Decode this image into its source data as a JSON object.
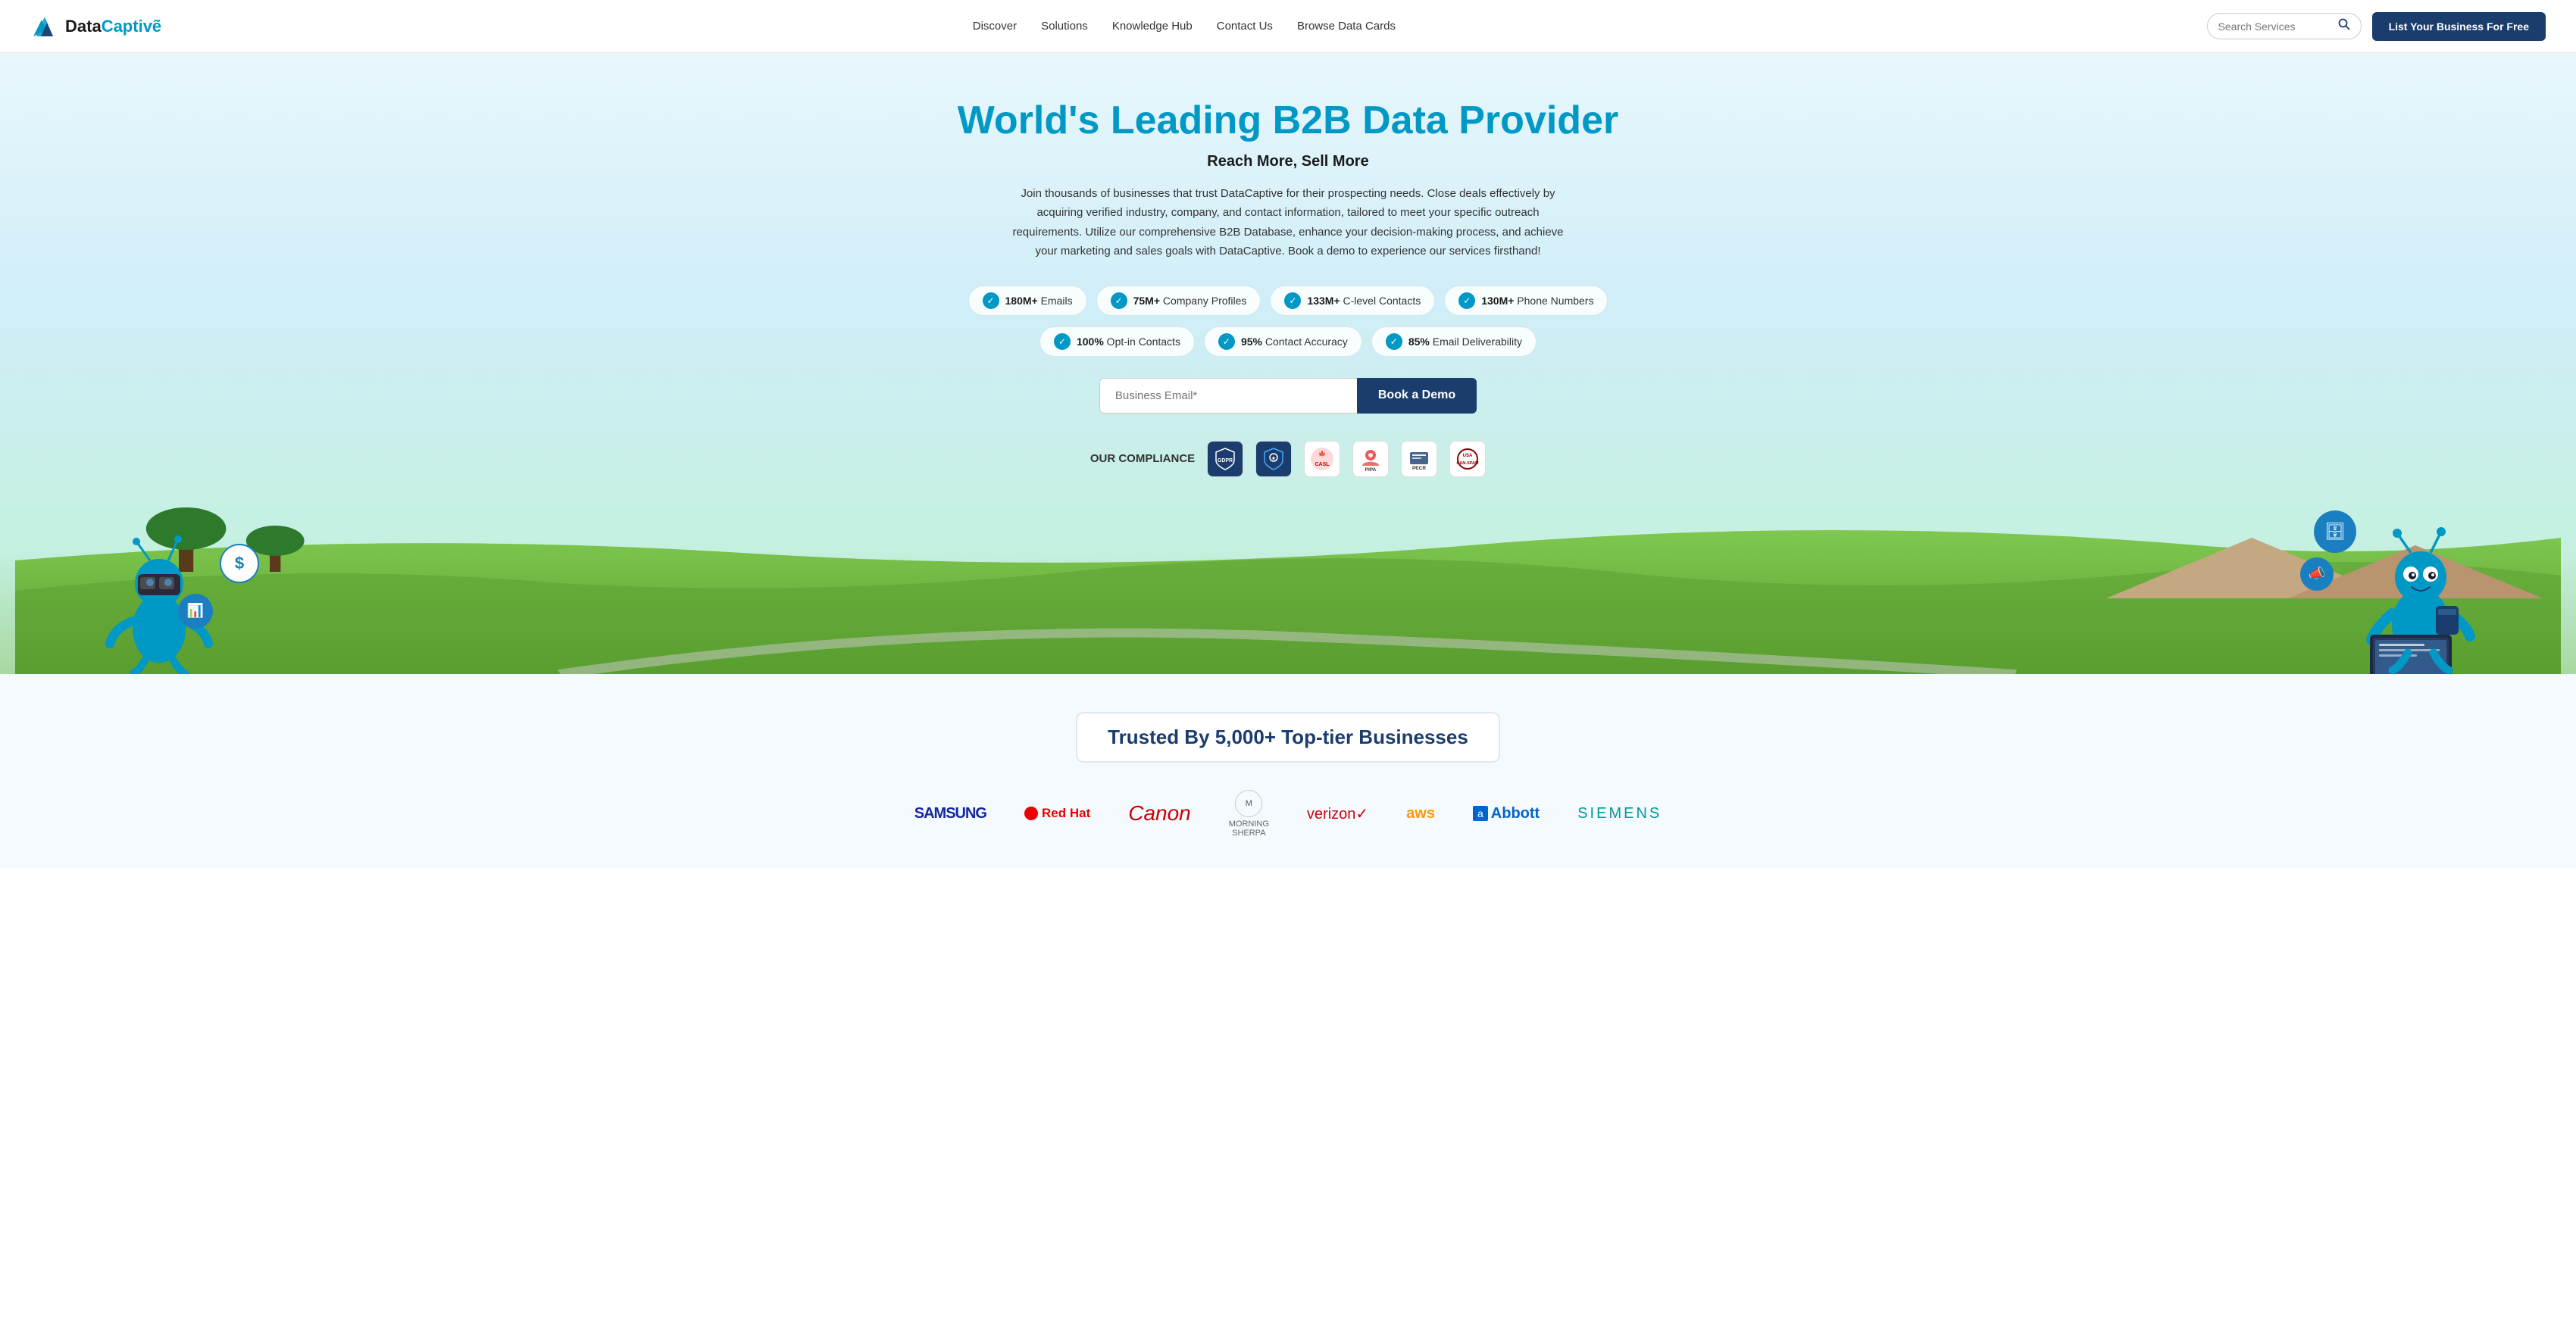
{
  "navbar": {
    "logo_data": "DataCaptive",
    "logo_part1": "Data",
    "logo_part2": "Captive",
    "nav_links": [
      {
        "label": "Discover",
        "href": "#"
      },
      {
        "label": "Solutions",
        "href": "#"
      },
      {
        "label": "Knowledge Hub",
        "href": "#"
      },
      {
        "label": "Contact Us",
        "href": "#"
      },
      {
        "label": "Browse Data Cards",
        "href": "#"
      }
    ],
    "search_placeholder": "Search Services",
    "list_btn_label": "List Your Business For Free"
  },
  "hero": {
    "title": "World's Leading B2B Data Provider",
    "subtitle": "Reach More, Sell More",
    "description": "Join thousands of businesses that trust DataCaptive for their prospecting needs. Close deals effectively by acquiring verified industry, company, and contact information, tailored to meet your specific outreach requirements. Utilize our comprehensive B2B Database, enhance your decision-making process, and achieve your marketing and sales goals with DataCaptive. Book a demo to experience our services firsthand!",
    "stats": [
      {
        "value": "180M+",
        "label": "Emails"
      },
      {
        "value": "75M+",
        "label": "Company Profiles"
      },
      {
        "value": "133M+",
        "label": "C-level Contacts"
      },
      {
        "value": "130M+",
        "label": "Phone Numbers"
      },
      {
        "value": "100%",
        "label": "Opt-in Contacts"
      },
      {
        "value": "95%",
        "label": "Contact Accuracy"
      },
      {
        "value": "85%",
        "label": "Email Deliverability"
      }
    ],
    "email_placeholder": "Business Email*",
    "book_btn_label": "Book a Demo",
    "compliance_label": "OUR COMPLIANCE",
    "compliance_badges": [
      {
        "label": "GDPR",
        "color": "#1a3d6e"
      },
      {
        "label": "CCPA",
        "color": "#1a3d6e"
      },
      {
        "label": "CASL",
        "color": "#cc0000"
      },
      {
        "label": "PIPA",
        "color": "#e83030"
      },
      {
        "label": "PECR",
        "color": "#333"
      },
      {
        "label": "CAN-SPAM",
        "color": "#666"
      }
    ]
  },
  "trusted": {
    "heading": "Trusted By 5,000+ Top-tier Businesses",
    "brands": [
      {
        "name": "SAMSUNG",
        "class": "brand-samsung"
      },
      {
        "name": "redhat",
        "class": "brand-redhat"
      },
      {
        "name": "Canon",
        "class": "brand-canon"
      },
      {
        "name": "Morning Sherpa",
        "class": "brand-logo"
      },
      {
        "name": "verizon✓",
        "class": "brand-verizon"
      },
      {
        "name": "aws",
        "class": "brand-aws"
      },
      {
        "name": "Abbott",
        "class": "brand-abbott"
      },
      {
        "name": "SIEMENS",
        "class": "brand-siemens"
      }
    ]
  }
}
